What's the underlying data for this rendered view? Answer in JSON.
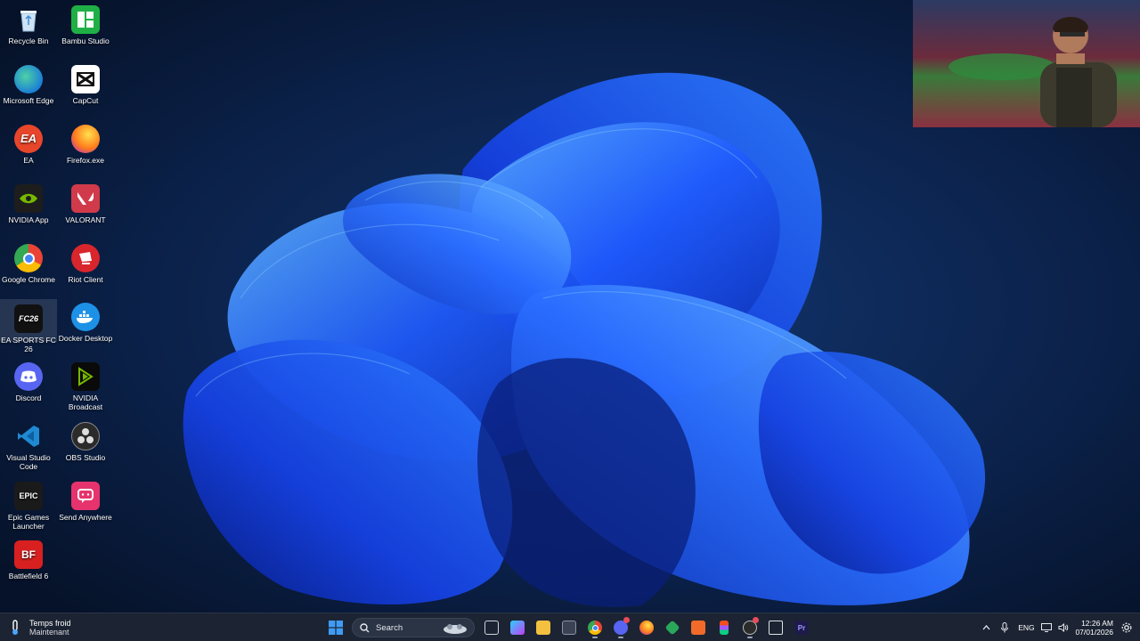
{
  "desktop": {
    "icons": [
      {
        "label": "Recycle Bin",
        "color": "#3a5b8a"
      },
      {
        "label": "Bambu Studio",
        "color": "#1fb045"
      },
      {
        "label": "Microsoft Edge",
        "color": "#1a7fd6"
      },
      {
        "label": "CapCut",
        "color": "#111111"
      },
      {
        "label": "EA",
        "color": "#e8462b"
      },
      {
        "label": "Firefox.exe",
        "color": "#ff7b1c"
      },
      {
        "label": "NVIDIA App",
        "color": "#1d1d1d"
      },
      {
        "label": "VALORANT",
        "color": "#d13a4a"
      },
      {
        "label": "Google Chrome",
        "color": "#e0e0e0"
      },
      {
        "label": "Riot Client",
        "color": "#d8262c"
      },
      {
        "label": "EA SPORTS FC 26",
        "color": "#111111"
      },
      {
        "label": "Docker Desktop",
        "color": "#1d91e6"
      },
      {
        "label": "Discord",
        "color": "#5865f2"
      },
      {
        "label": "NVIDIA Broadcast",
        "color": "#0a0a0a"
      },
      {
        "label": "Visual Studio Code",
        "color": "#1f8ad2"
      },
      {
        "label": "OBS Studio",
        "color": "#2b2b2b"
      },
      {
        "label": "Epic Games Launcher",
        "color": "#1a1a1a"
      },
      {
        "label": "Send Anywhere",
        "color": "#e6336e"
      },
      {
        "label": "Battlefield 6",
        "color": "#d82020"
      }
    ]
  },
  "taskbar": {
    "weather": {
      "title": "Temps froid",
      "subtitle": "Maintenant"
    },
    "search": {
      "label": "Search"
    },
    "tray": {
      "language": "ENG",
      "time": "12:26 AM",
      "date": "07/01/2026"
    }
  },
  "colors": {
    "taskbar_bg": "#1c2433",
    "start_blue": "#3f9bf5",
    "wallpaper_accent": "#1f5bff"
  }
}
